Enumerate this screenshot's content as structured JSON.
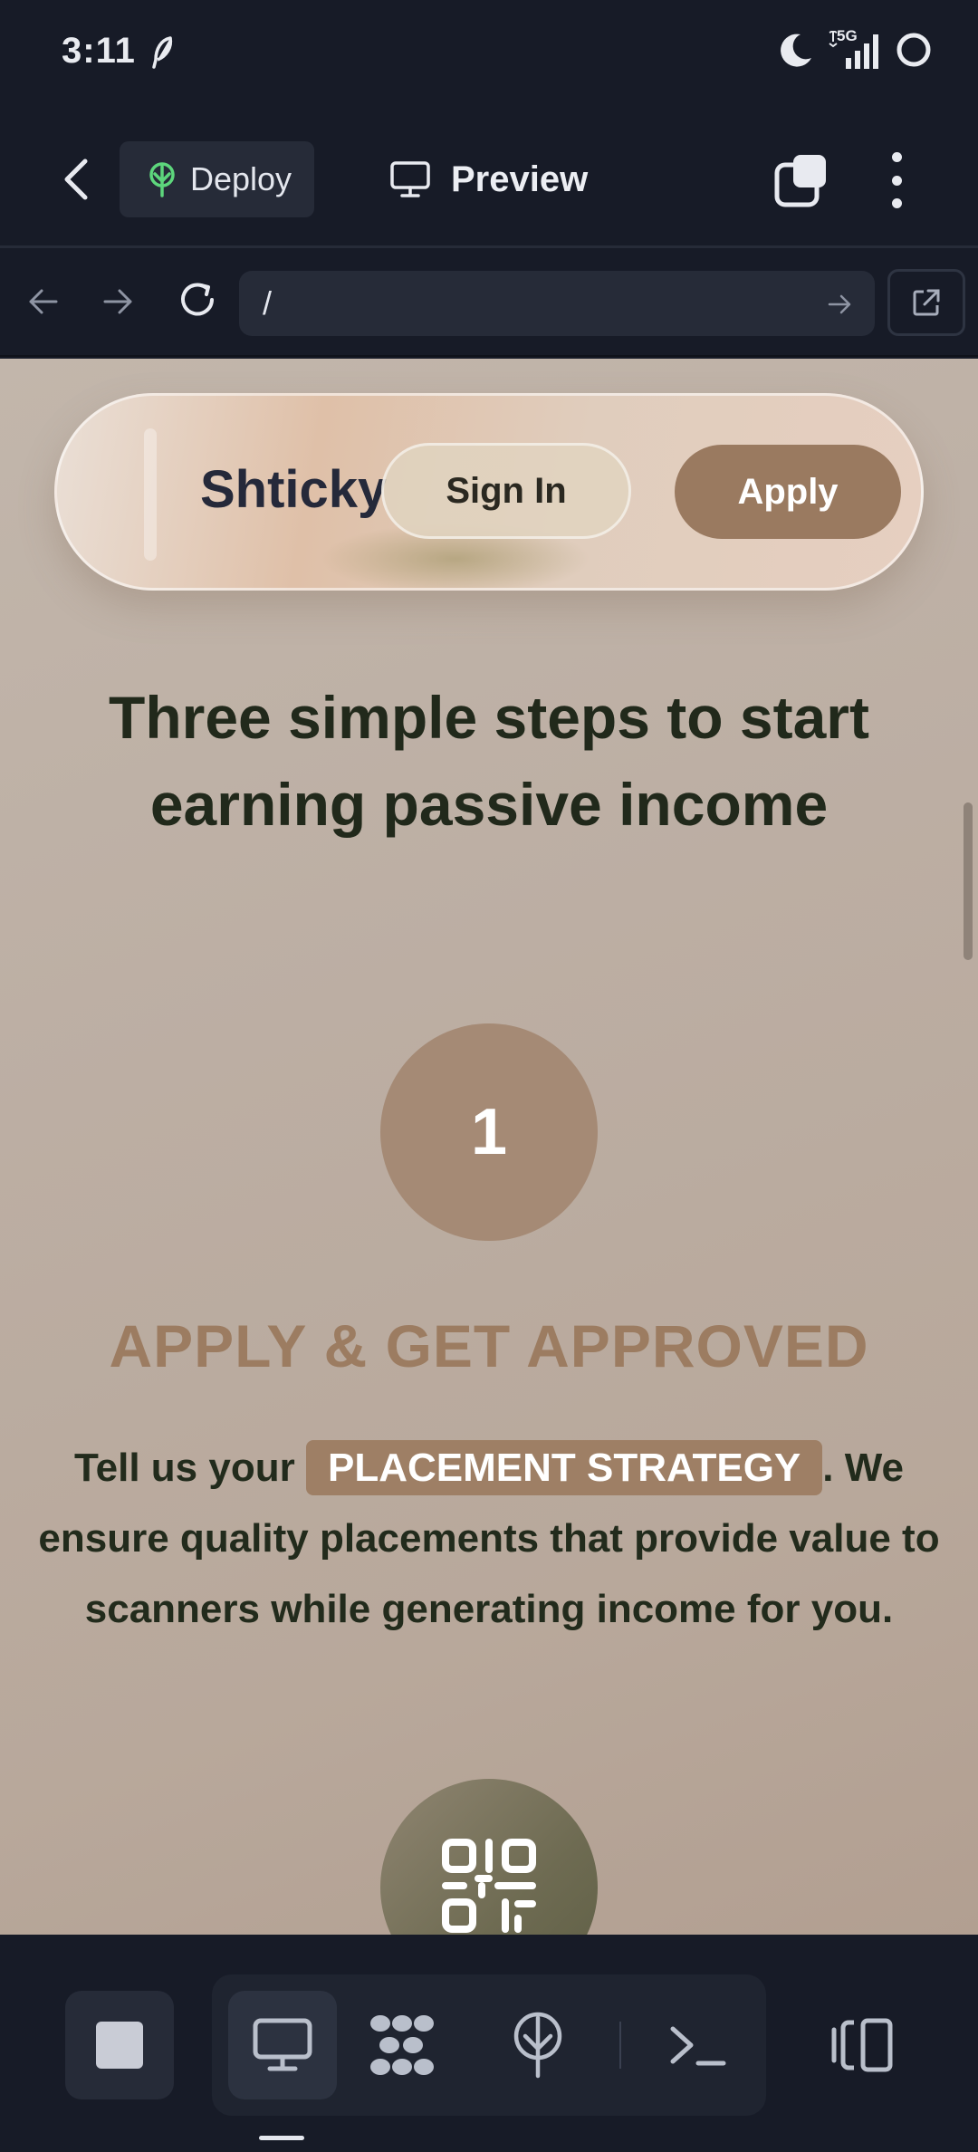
{
  "status_bar": {
    "time": "3:11",
    "network_label": "5G",
    "icons": [
      "feather-icon",
      "moon-icon",
      "signal-icon",
      "ring-icon"
    ]
  },
  "toolbar": {
    "deploy_label": "Deploy",
    "preview_label": "Preview",
    "icons": [
      "back-arrow-icon",
      "deploy-tree-icon",
      "monitor-icon",
      "multi-window-icon",
      "kebab-menu-icon"
    ],
    "deploy_icon_color": "#5dd67c"
  },
  "url_bar": {
    "url": "/"
  },
  "site": {
    "nav": {
      "brand": "Shticky",
      "signin_label": "Sign In",
      "apply_label": "Apply"
    },
    "headline": "Three simple steps to start earning passive income",
    "step1": {
      "number": "1",
      "title": "APPLY & GET APPROVED",
      "body_prefix": "Tell us your",
      "body_highlight": "PLACEMENT STRATEGY",
      "body_suffix": ". We ensure quality placements that provide value to scanners while generating income for you."
    },
    "step2": {
      "icon": "qr-code-icon"
    },
    "colors": {
      "accent": "#9a7a60",
      "heading": "#21291b",
      "title_accent": "#9c7c61"
    }
  },
  "dock": {
    "items": [
      "stop-icon",
      "desktop-icon",
      "extensions-icon",
      "deploy-icon",
      "terminal-icon",
      "layout-icon"
    ]
  }
}
